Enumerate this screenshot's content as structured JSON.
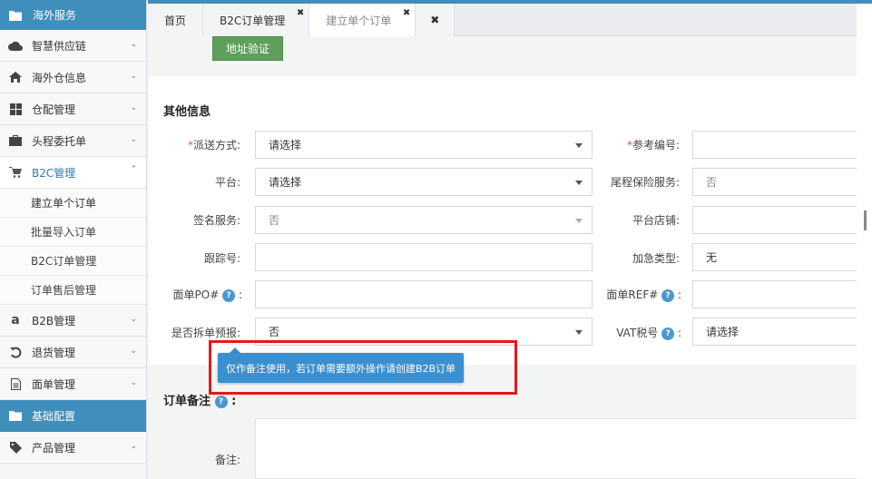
{
  "sidebar": {
    "header": {
      "label": "海外服务",
      "icon": "folder-icon"
    },
    "items": [
      {
        "label": "智慧供应链",
        "icon": "cloud-icon"
      },
      {
        "label": "海外仓信息",
        "icon": "home-icon"
      },
      {
        "label": "仓配管理",
        "icon": "grid-icon"
      },
      {
        "label": "头程委托单",
        "icon": "briefcase-icon"
      },
      {
        "label": "B2C管理",
        "icon": "cart-icon",
        "expanded": true
      }
    ],
    "b2c_subitems": [
      "建立单个订单",
      "批量导入订单",
      "B2C订单管理",
      "订单售后管理"
    ],
    "items_after": [
      {
        "label": "B2B管理",
        "icon": "amazon-icon"
      },
      {
        "label": "退货管理",
        "icon": "return-icon"
      },
      {
        "label": "面单管理",
        "icon": "document-icon"
      }
    ],
    "section2": {
      "label": "基础配置",
      "icon": "folder-icon"
    },
    "items_last": [
      {
        "label": "产品管理",
        "icon": "tag-icon"
      }
    ]
  },
  "tabs": [
    {
      "label": "首页"
    },
    {
      "label": "B2C订单管理"
    },
    {
      "label": "建立单个订单",
      "active": true
    }
  ],
  "main": {
    "verify_button": "地址验证",
    "other_info_title": "其他信息",
    "required_mark": "*",
    "fields": {
      "delivery_method_label": "派送方式:",
      "delivery_method_value": "请选择",
      "reference_no_label": "参考编号:",
      "platform_label": "平台:",
      "platform_value": "请选择",
      "tail_insurance_label": "尾程保险服务:",
      "tail_insurance_value": "否",
      "signature_label": "签名服务:",
      "signature_value": "否",
      "platform_store_label": "平台店铺:",
      "tracking_no_label": "跟踪号:",
      "urgent_type_label": "加急类型:",
      "urgent_type_value": "无",
      "label_po_label": "面单PO#",
      "label_ref_label": "面单REF#",
      "split_order_label": "是否拆单预报:",
      "split_order_value": "否",
      "vat_label": "VAT税号",
      "vat_value": "请选择",
      "colon": ":"
    },
    "order_remarks_title": "订单备注",
    "remarks_label": "备注:",
    "tooltip": "仅作备注使用，若订单需要额外操作请创建B2B订单",
    "help_glyph": "?"
  },
  "colors": {
    "sidebar_header": "#3f8ebc",
    "verify_button": "#5d9f5b",
    "tooltip": "#3a8fd0",
    "highlight": "#e11a1a"
  }
}
